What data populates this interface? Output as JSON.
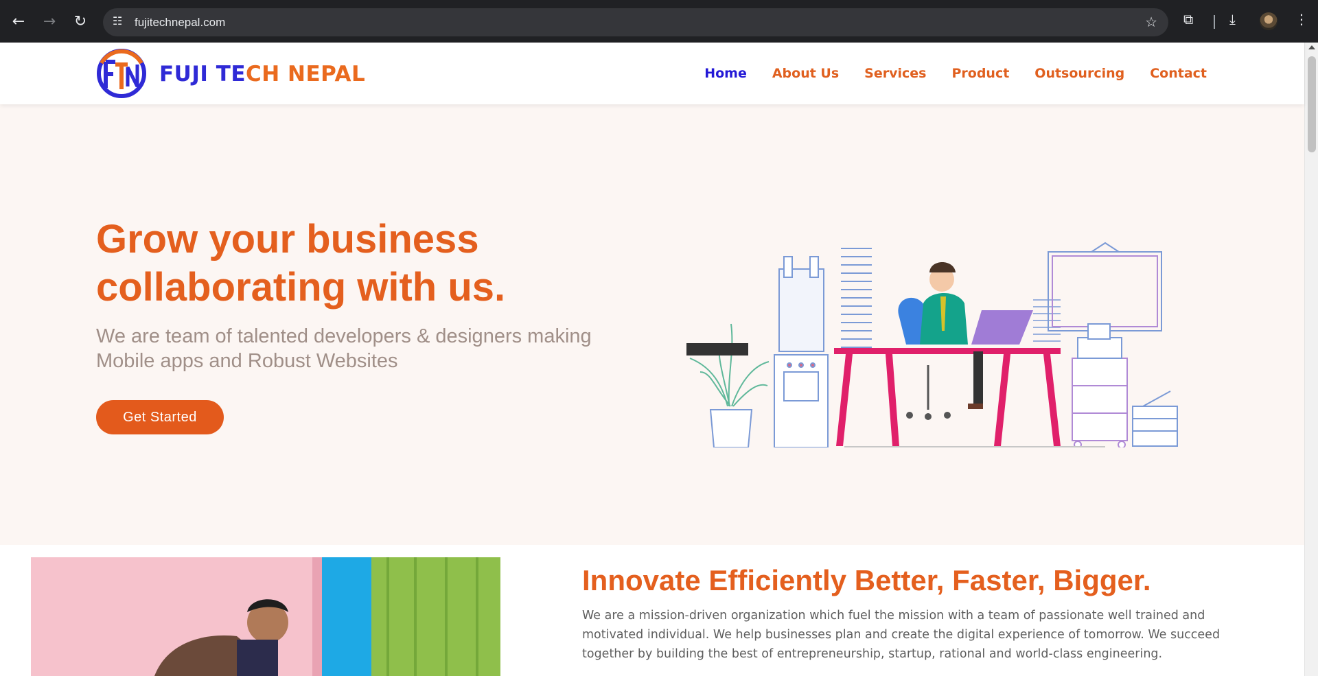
{
  "browser": {
    "url": "fujitechnepal.com",
    "back_icon": "←",
    "forward_icon": "→",
    "reload_icon": "↻",
    "site_settings_icon": "☷",
    "bookmark_icon": "☆",
    "extensions_icon": "⧉",
    "download_icon": "⤓",
    "menu_icon": "⋮"
  },
  "header": {
    "logo_mark_text": "FTN",
    "logo_part1": "FUJI TE",
    "logo_part2": "CH NEPAL",
    "nav": [
      "Home",
      "About Us",
      "Services",
      "Product",
      "Outsourcing",
      "Contact"
    ],
    "active_nav": "Home"
  },
  "hero": {
    "title": "Grow your business collaborating with us.",
    "subtitle": "We are team of talented developers & designers making Mobile apps and Robust Websites",
    "cta_label": "Get Started"
  },
  "about": {
    "title": "Innovate Efficiently Better, Faster, Bigger.",
    "body": "We are a mission-driven organization which fuel the mission with a team of passionate well trained and motivated individual. We help businesses plan and create the digital experience of tomorrow. We succeed together by building the best of entrepreneurship, startup, rational and world-class engineering."
  },
  "colors": {
    "brand_orange": "#e45f1e",
    "brand_blue": "#2318d6",
    "hero_bg": "#fcf6f3"
  }
}
